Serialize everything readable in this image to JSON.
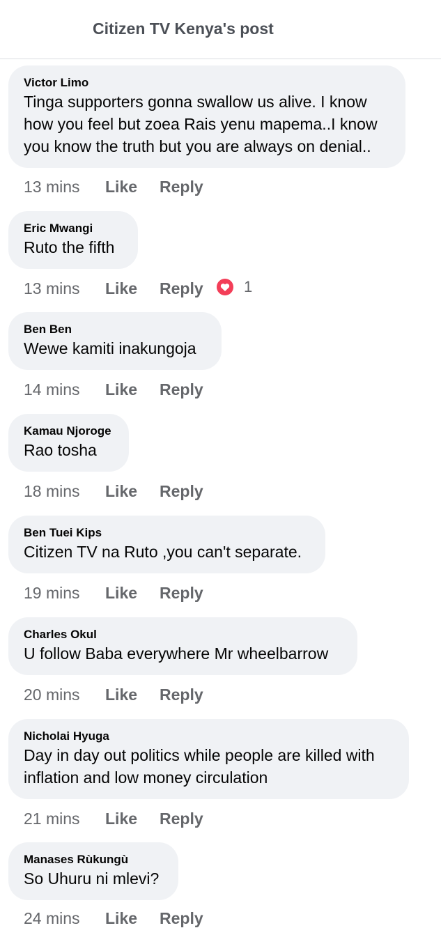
{
  "header": {
    "title": "Citizen TV Kenya's post"
  },
  "actions": {
    "like": "Like",
    "reply": "Reply"
  },
  "comments": [
    {
      "author": "Victor Limo",
      "lines": [
        "Tinga supporters gonna swallow us alive. I know",
        "how you feel but zoea Rais yenu mapema..I know",
        "you know the truth but you are always on denial.."
      ],
      "time": "13 mins"
    },
    {
      "author": "Eric Mwangi",
      "lines": [
        "Ruto the fifth"
      ],
      "time": "13 mins",
      "reaction": {
        "icon": "love-reaction-icon",
        "color": "#f33e58",
        "count": "1"
      }
    },
    {
      "author": "Ben Ben",
      "lines": [
        "Wewe kamiti inakungoja"
      ],
      "time": "14 mins"
    },
    {
      "author": "Kamau Njoroge",
      "lines": [
        "Rao tosha"
      ],
      "time": "18 mins"
    },
    {
      "author": "Ben Tuei Kips",
      "lines": [
        "Citizen TV na Ruto ,you can't separate."
      ],
      "time": "19 mins"
    },
    {
      "author": "Charles Okul",
      "lines": [
        "U follow Baba everywhere Mr wheelbarrow"
      ],
      "time": "20 mins"
    },
    {
      "author": "Nicholai Hyuga",
      "lines": [
        "Day in day out politics while people are killed with",
        "inflation and low money circulation"
      ],
      "time": "21 mins"
    },
    {
      "author": "Manases Rùkungù",
      "lines": [
        "So Uhuru ni mlevi?"
      ],
      "time": "24 mins"
    }
  ]
}
